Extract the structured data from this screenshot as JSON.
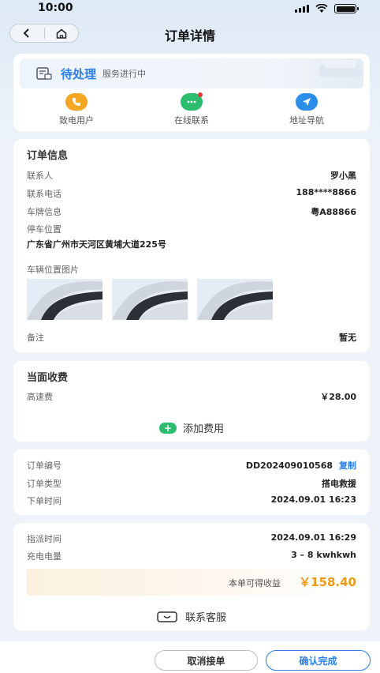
{
  "status_bar": {
    "time": "10:00"
  },
  "nav": {
    "title": "订单详情"
  },
  "status": {
    "label": "待处理",
    "desc": "服务进行中",
    "actions": [
      {
        "label": "致电用户",
        "icon": "phone-icon",
        "color": "#f5a623"
      },
      {
        "label": "在线联系",
        "icon": "chat-icon",
        "color": "#2dbd6e"
      },
      {
        "label": "地址导航",
        "icon": "navigation-icon",
        "color": "#2c8ee8"
      }
    ]
  },
  "order_info": {
    "title": "订单信息",
    "contact_label": "联系人",
    "contact_value": "罗小黑",
    "phone_label": "联系电话",
    "phone_value": "188****8866",
    "plate_label": "车牌信息",
    "plate_value": "粤A88866",
    "location_label": "停车位置",
    "location_value": "广东省广州市天河区黄埔大道225号",
    "photos_label": "车辆位置图片",
    "remark_label": "备注",
    "remark_value": "暂无"
  },
  "fees": {
    "title": "当面收费",
    "item_label": "高速费",
    "item_value": "￥28.00",
    "add_label": "添加费用"
  },
  "meta": {
    "order_no_label": "订单编号",
    "order_no_value": "DD202409010568",
    "copy_label": "复制",
    "type_label": "订单类型",
    "type_value": "搭电救援",
    "time_label": "下单时间",
    "time_value": "2024.09.01 16:23"
  },
  "dispatch": {
    "time_label": "指派时间",
    "time_value": "2024.09.01 16:29",
    "charge_label": "充电电量",
    "charge_value": "3 – 8 kwhkwh",
    "income_label": "本单可得收益",
    "income_value": "￥158.40",
    "cs_label": "联系客服"
  },
  "buttons": {
    "cancel": "取消接单",
    "confirm": "确认完成"
  },
  "colors": {
    "accent": "#2c7fe8",
    "income": "#ef9a17"
  }
}
